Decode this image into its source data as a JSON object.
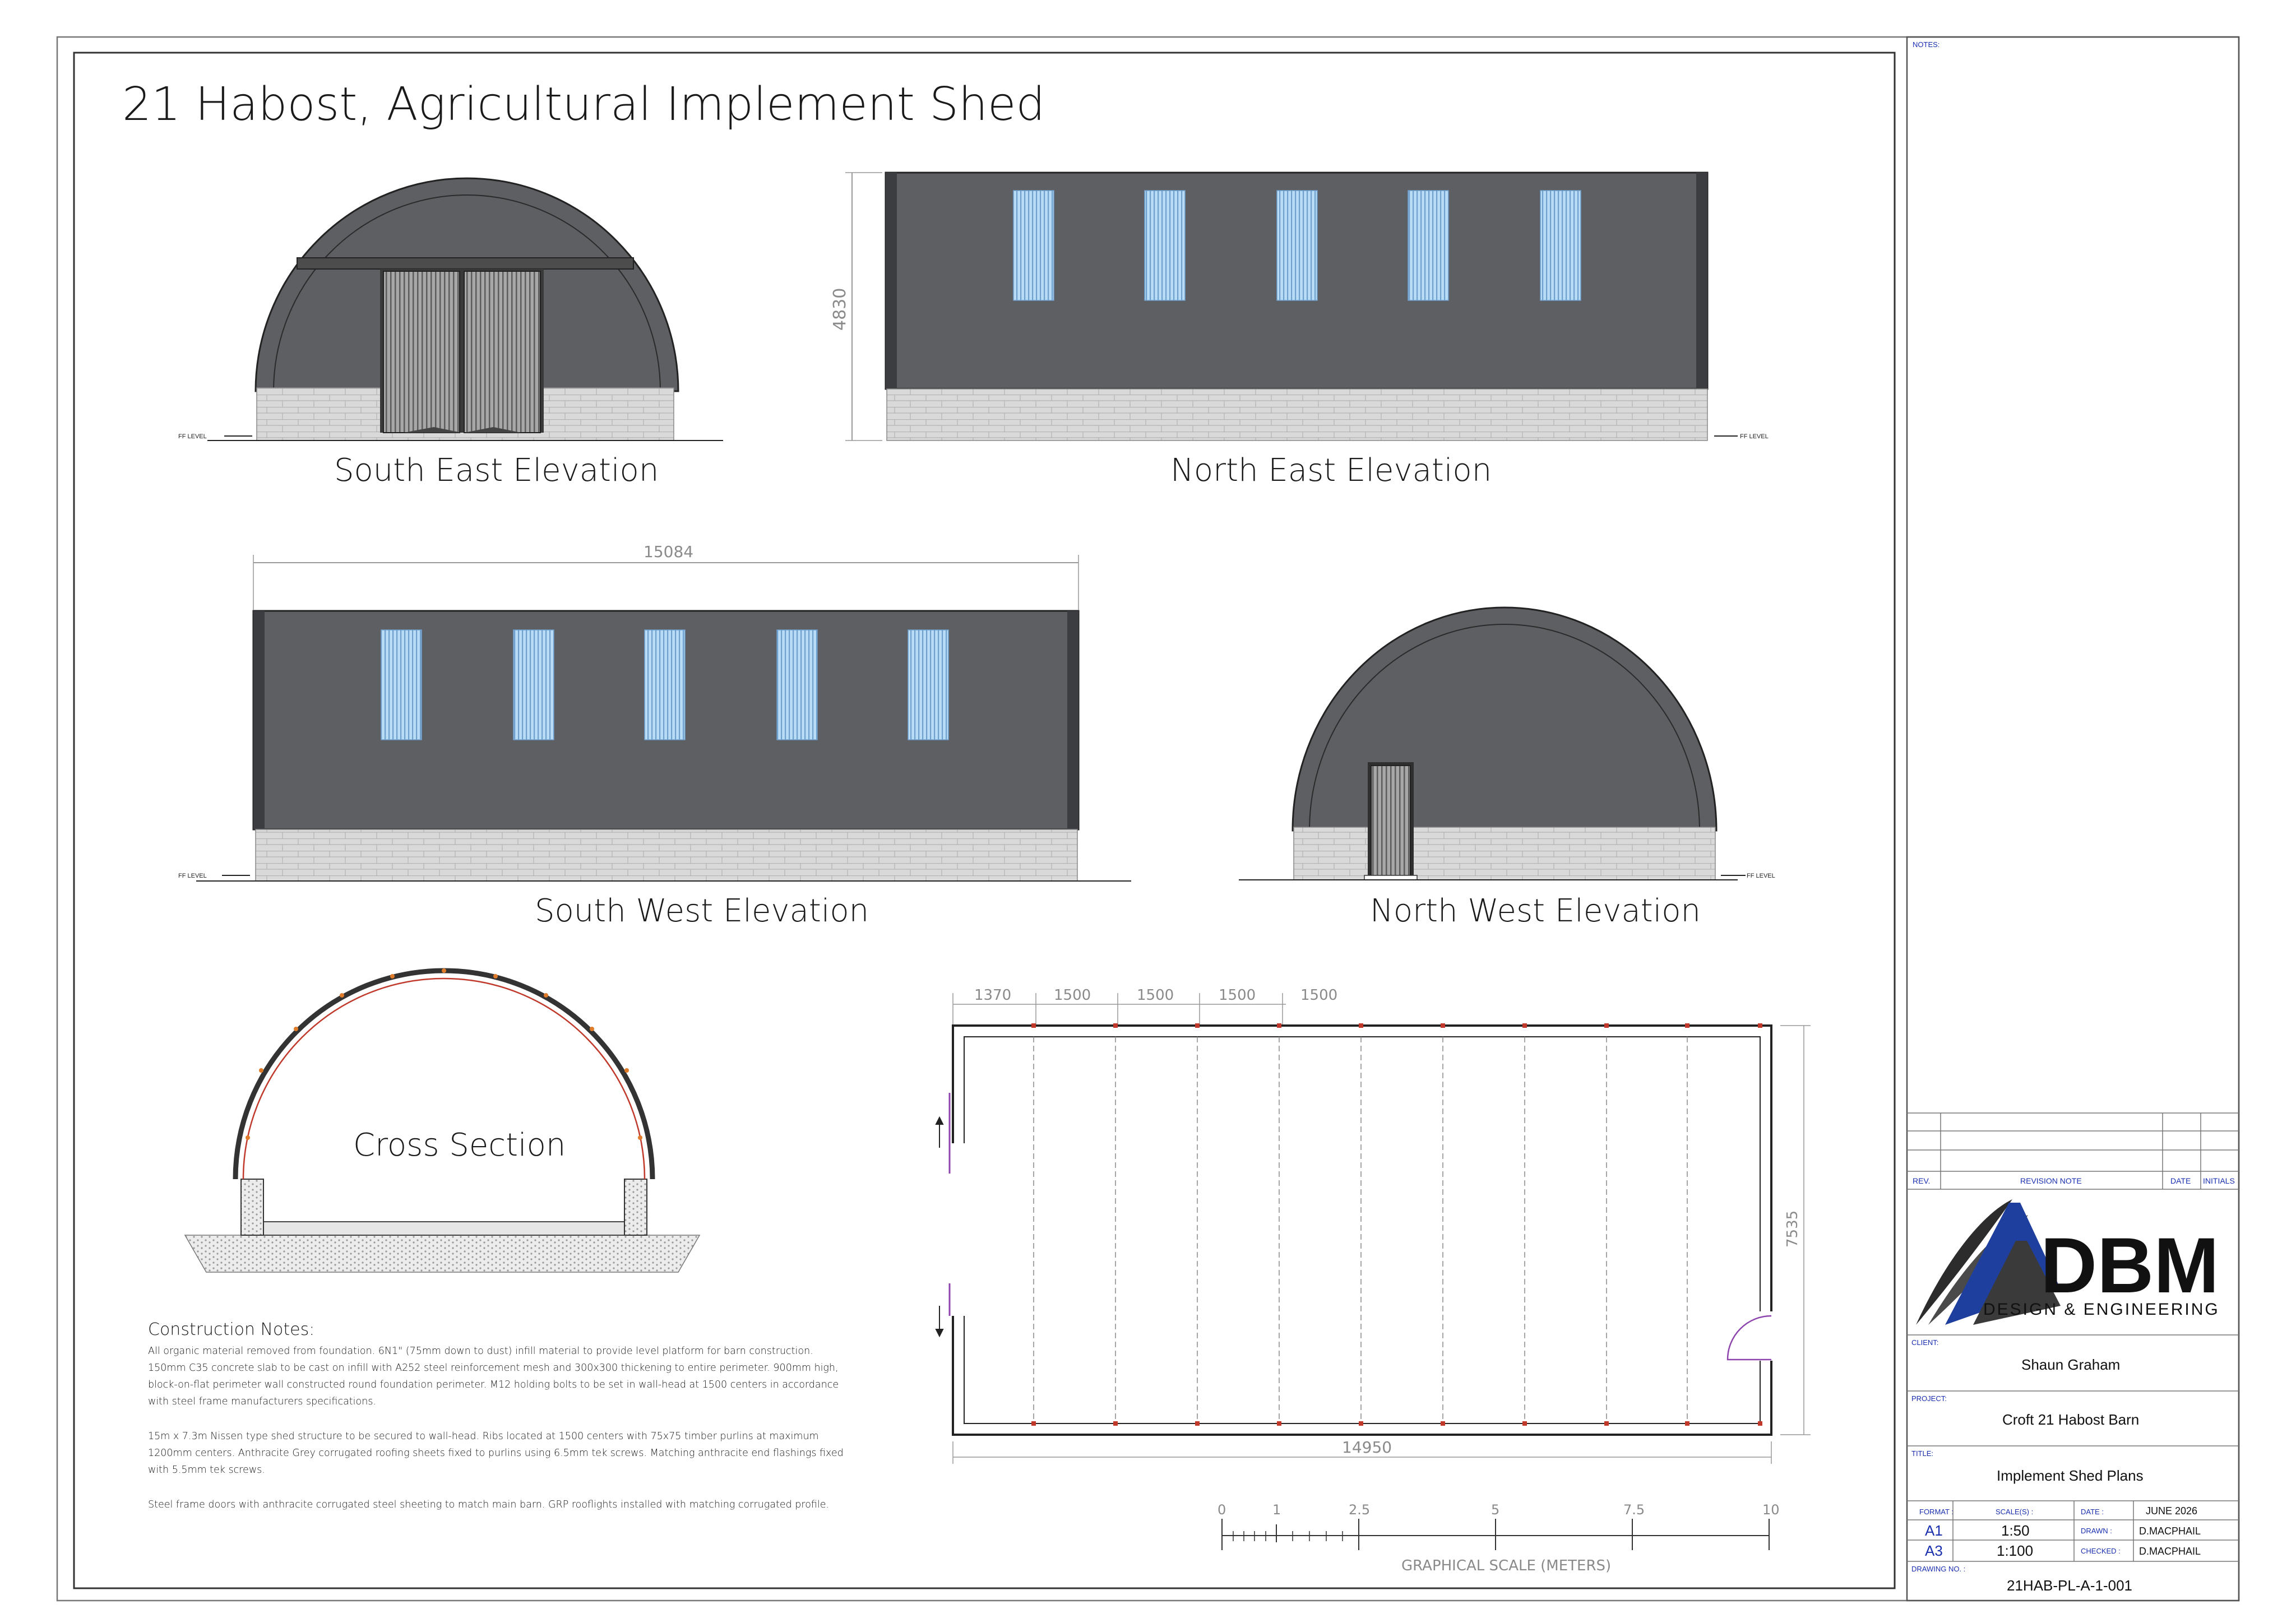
{
  "sheet": {
    "title": "21 Habost, Agricultural Implement Shed",
    "views": {
      "south_east": "South East Elevation",
      "north_east": "North East Elevation",
      "south_west": "South West Elevation",
      "north_west": "North West Elevation",
      "cross_section": "Cross Section"
    },
    "ff_level": "FF LEVEL",
    "dimensions": {
      "height": "4830",
      "length_sw": "15084",
      "plan_length": "14950",
      "plan_width": "7535",
      "first_bay": "1370",
      "bay": "1500"
    },
    "notes": {
      "heading": "Construction Notes:",
      "lines": [
        "All organic material removed from foundation. 6N1\" (75mm down to dust) infill material to provide level platform for barn construction.",
        "150mm C35 concrete slab to be cast on infill with A252 steel reinforcement mesh and 300x300 thickening to entire perimeter. 900mm high,",
        "block-on-flat perimeter wall constructed round foundation perimeter. M12 holding bolts to be set in wall-head at 1500 centers in accordance",
        "with steel frame manufacturers specifications.",
        "15m x 7.3m Nissen type shed structure to be secured to wall-head. Ribs located at 1500 centers with 75x75 timber purlins at maximum",
        "1200mm centers. Anthracite Grey corrugated roofing sheets fixed to purlins using 6.5mm tek screws. Matching anthracite end flashings fixed",
        "with 5.5mm tek screws.",
        "Steel frame doors with anthracite corrugated steel sheeting to match main barn. GRP rooflights installed with matching corrugated profile."
      ]
    },
    "scale_bar": {
      "ticks": [
        "0",
        "1",
        "2.5",
        "5",
        "7.5",
        "10"
      ],
      "caption": "GRAPHICAL SCALE (METERS)"
    }
  },
  "title_block": {
    "notes_label": "NOTES:",
    "rev_header": {
      "rev": "REV.",
      "note": "REVISION NOTE",
      "date": "DATE",
      "initials": "INITIALS"
    },
    "logo": {
      "text": "DBM",
      "tagline": "DESIGN & ENGINEERING"
    },
    "client_label": "CLIENT:",
    "client": "Shaun Graham",
    "project_label": "PROJECT:",
    "project": "Croft 21 Habost Barn",
    "title_label": "TITLE:",
    "title": "Implement Shed Plans",
    "format_label": "FORMAT :",
    "scales_label": "SCALE(S) :",
    "date_label": "DATE :",
    "date": "JUNE 2026",
    "formats": [
      {
        "format": "A1",
        "scale": "1:50",
        "role_label": "DRAWN :",
        "person": "D.MACPHAIL"
      },
      {
        "format": "A3",
        "scale": "1:100",
        "role_label": "CHECKED :",
        "person": "D.MACPHAIL"
      }
    ],
    "drawing_no_label": "DRAWING NO. :",
    "drawing_no": "21HAB-PL-A-1-001"
  }
}
